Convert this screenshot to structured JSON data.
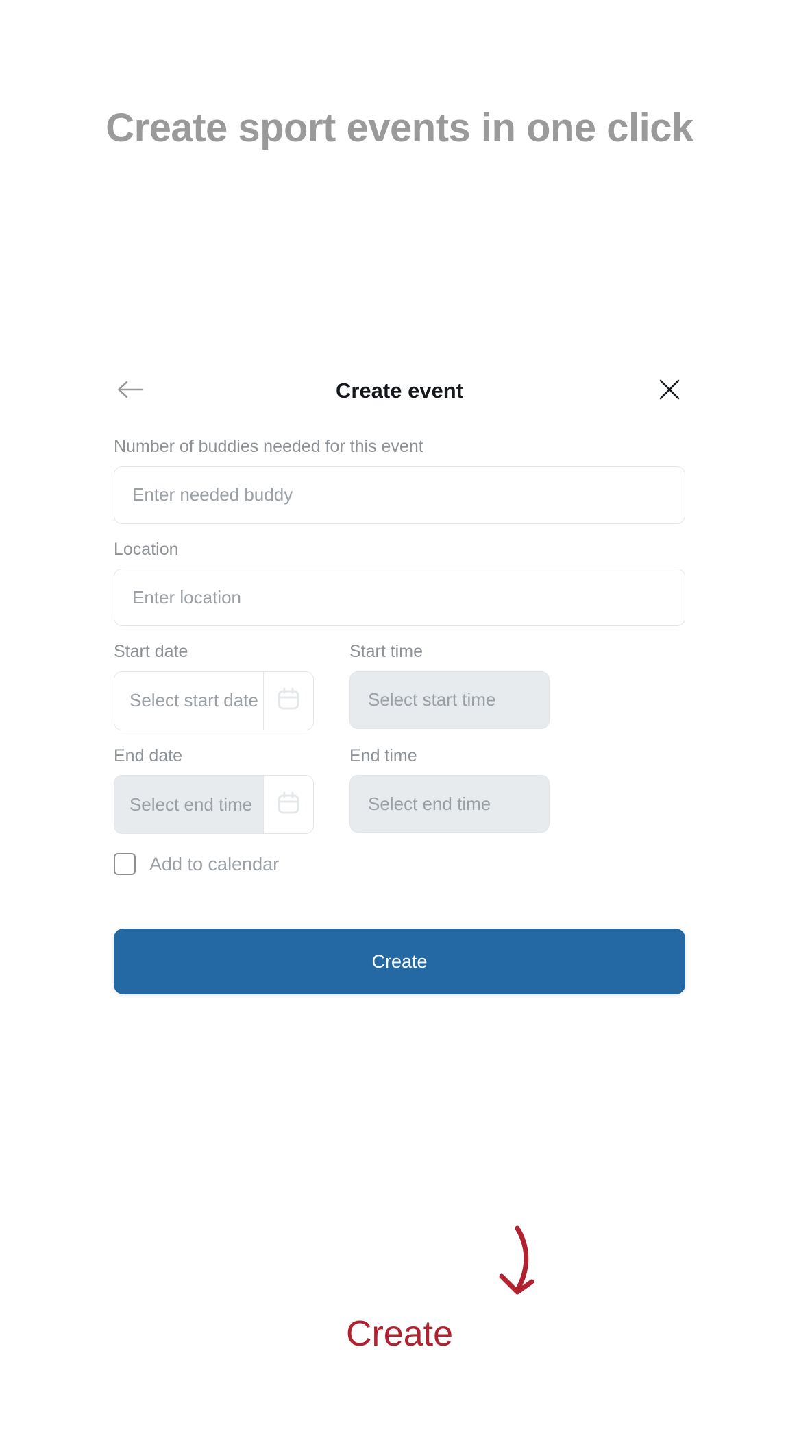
{
  "hero": {
    "title": "Create sport events in one click"
  },
  "modal": {
    "title": "Create event",
    "back_icon": "arrow-left-icon",
    "close_icon": "close-icon"
  },
  "form": {
    "buddies": {
      "label": "Number of buddies needed for this event",
      "placeholder": "Enter needed buddy",
      "value": ""
    },
    "location": {
      "label": "Location",
      "placeholder": "Enter location",
      "value": ""
    },
    "start_date": {
      "label": "Start date",
      "placeholder": "Select start date",
      "value": "",
      "icon": "calendar-icon"
    },
    "start_time": {
      "label": "Start time",
      "placeholder": "Select start time",
      "value": ""
    },
    "end_date": {
      "label": "End date",
      "placeholder": "Select end time",
      "value": "",
      "icon": "calendar-icon"
    },
    "end_time": {
      "label": "End time",
      "placeholder": "Select end time",
      "value": ""
    },
    "add_to_calendar": {
      "label": "Add to calendar",
      "checked": false
    },
    "submit_label": "Create"
  },
  "annotation": {
    "label": "Create",
    "arrow_icon": "curved-arrow-down-icon",
    "color": "#b02230"
  },
  "colors": {
    "primary": "#2468a4",
    "heading": "#9a9a9a",
    "label": "#8d9297",
    "placeholder": "#9aa0a6",
    "field_border": "#e2e6ea",
    "field_disabled_bg": "#e7ebee",
    "annotation_red": "#b02230"
  }
}
